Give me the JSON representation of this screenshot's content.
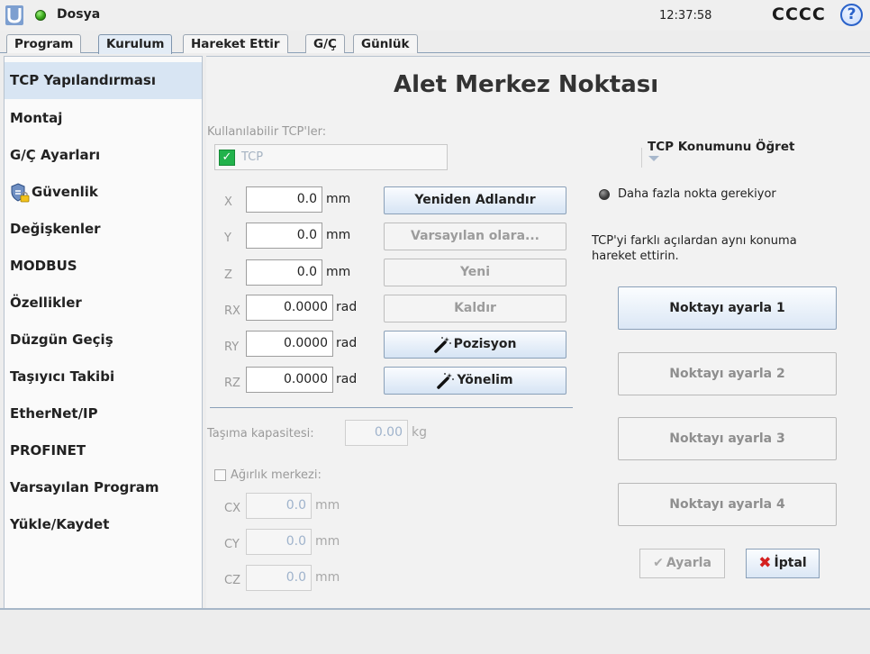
{
  "header": {
    "menu_label": "Dosya",
    "clock": "12:37:58",
    "robot_name": "CCCC",
    "help_glyph": "?"
  },
  "tabs": [
    {
      "label": "Program",
      "active": false
    },
    {
      "label": "Kurulum",
      "active": true
    },
    {
      "label": "Hareket Ettir",
      "active": false
    },
    {
      "label": "G/Ç",
      "active": false
    },
    {
      "label": "Günlük",
      "active": false
    }
  ],
  "sidebar": {
    "items": [
      {
        "label": "TCP Yapılandırması",
        "active": true
      },
      {
        "label": "Montaj"
      },
      {
        "label": "G/Ç Ayarları"
      },
      {
        "label": "Güvenlik",
        "icon": "shield-lock-icon"
      },
      {
        "label": "Değişkenler"
      },
      {
        "label": "MODBUS"
      },
      {
        "label": "Özellikler"
      },
      {
        "label": "Düzgün Geçiş"
      },
      {
        "label": "Taşıyıcı Takibi"
      },
      {
        "label": "EtherNet/IP"
      },
      {
        "label": "PROFINET"
      },
      {
        "label": "Varsayılan Program"
      },
      {
        "label": "Yükle/Kaydet"
      }
    ]
  },
  "main": {
    "title": "Alet Merkez Noktası",
    "available_tcps_label": "Kullanılabilir TCP'ler:",
    "tcp_select_value": "TCP",
    "coords": [
      {
        "label": "X",
        "value": "0.0",
        "unit": "mm"
      },
      {
        "label": "Y",
        "value": "0.0",
        "unit": "mm"
      },
      {
        "label": "Z",
        "value": "0.0",
        "unit": "mm"
      },
      {
        "label": "RX",
        "value": "0.0000",
        "unit": "rad"
      },
      {
        "label": "RY",
        "value": "0.0000",
        "unit": "rad"
      },
      {
        "label": "RZ",
        "value": "0.0000",
        "unit": "rad"
      }
    ],
    "buttons": {
      "rename": "Yeniden Adlandır",
      "set_default": "Varsayılan olara...",
      "new": "Yeni",
      "remove": "Kaldır",
      "position": "Pozisyon",
      "orientation": "Yönelim"
    },
    "payload_label": "Taşıma kapasitesi:",
    "payload_value": "0.00",
    "payload_unit": "kg",
    "cog_label": "Ağırlık merkezi:",
    "cog_checked": false,
    "cog": [
      {
        "label": "CX",
        "value": "0.0",
        "unit": "mm"
      },
      {
        "label": "CY",
        "value": "0.0",
        "unit": "mm"
      },
      {
        "label": "CZ",
        "value": "0.0",
        "unit": "mm"
      }
    ],
    "teach": {
      "title": "TCP Konumunu Öğret",
      "status": "Daha fazla nokta gerekiyor",
      "instruction_line1": "TCP'yi farklı açılardan aynı konuma",
      "instruction_line2": "hareket ettirin.",
      "points": [
        {
          "label": "Noktayı ayarla 1",
          "enabled": true
        },
        {
          "label": "Noktayı ayarla 2",
          "enabled": false
        },
        {
          "label": "Noktayı ayarla 3",
          "enabled": false
        },
        {
          "label": "Noktayı ayarla 4",
          "enabled": false
        }
      ],
      "apply_label": "Ayarla",
      "cancel_label": "İptal"
    }
  },
  "colors": {
    "accent_blue": "#2a62c9",
    "status_green": "#38a81a",
    "tcp_green": "#22b24c",
    "cancel_red": "#d42020"
  }
}
